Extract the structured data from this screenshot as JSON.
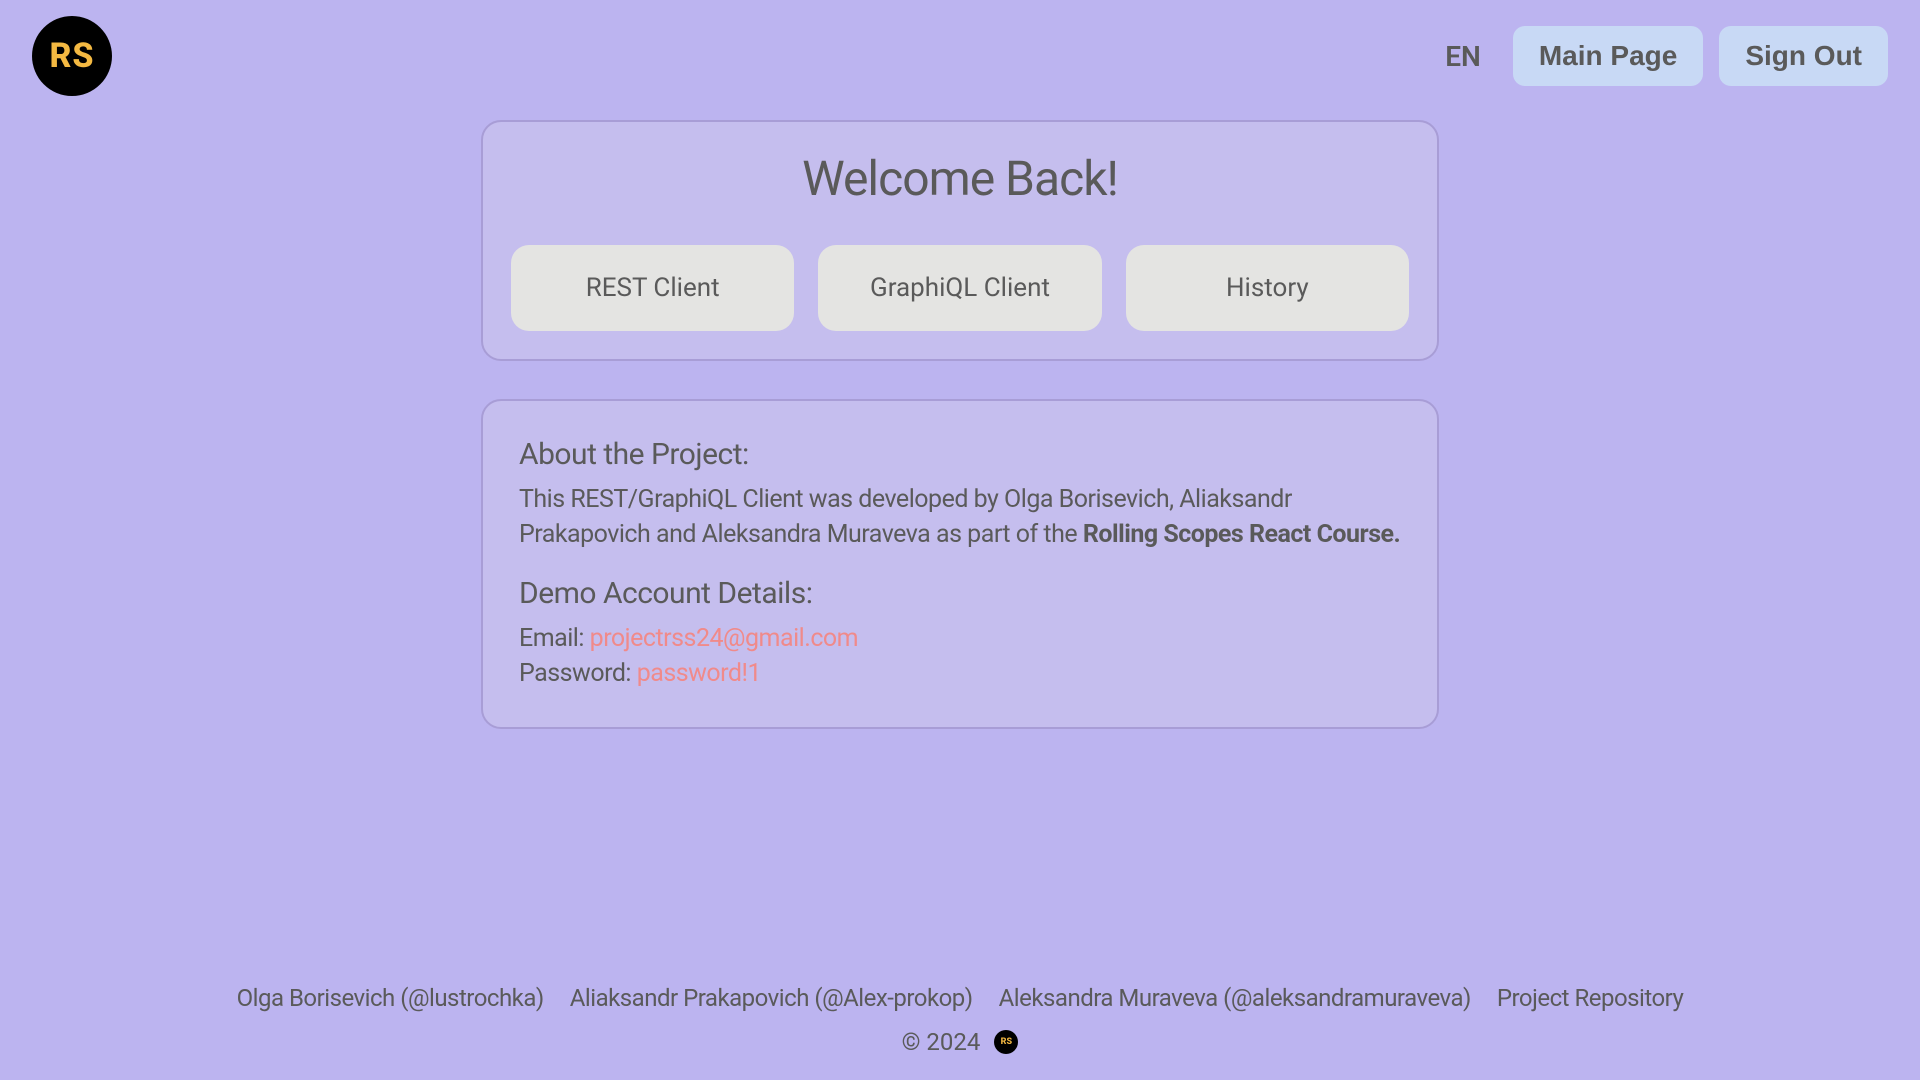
{
  "header": {
    "logo_text": "RS",
    "lang": "EN",
    "main_page": "Main Page",
    "sign_out": "Sign Out"
  },
  "welcome": {
    "title": "Welcome Back!",
    "buttons": {
      "rest": "REST Client",
      "graphiql": "GraphiQL Client",
      "history": "History"
    }
  },
  "about": {
    "heading": "About the Project:",
    "text_before": "This REST/GraphiQL Client was developed by Olga Borisevich, Aliaksandr Prakapovich and Aleksandra Muraveva as part of the ",
    "text_bold": "Rolling Scopes React Course.",
    "demo_heading": "Demo Account Details:",
    "email_label": "Email: ",
    "email_value": "projectrss24@gmail.com",
    "password_label": "Password: ",
    "password_value": "password!1"
  },
  "footer": {
    "links": [
      "Olga Borisevich (@lustrochka)",
      "Aliaksandr Prakapovich (@Alex-prokop)",
      "Aleksandra Muraveva (@aleksandramuraveva)",
      "Project Repository"
    ],
    "copyright": "© 2024",
    "logo_text": "RS"
  }
}
